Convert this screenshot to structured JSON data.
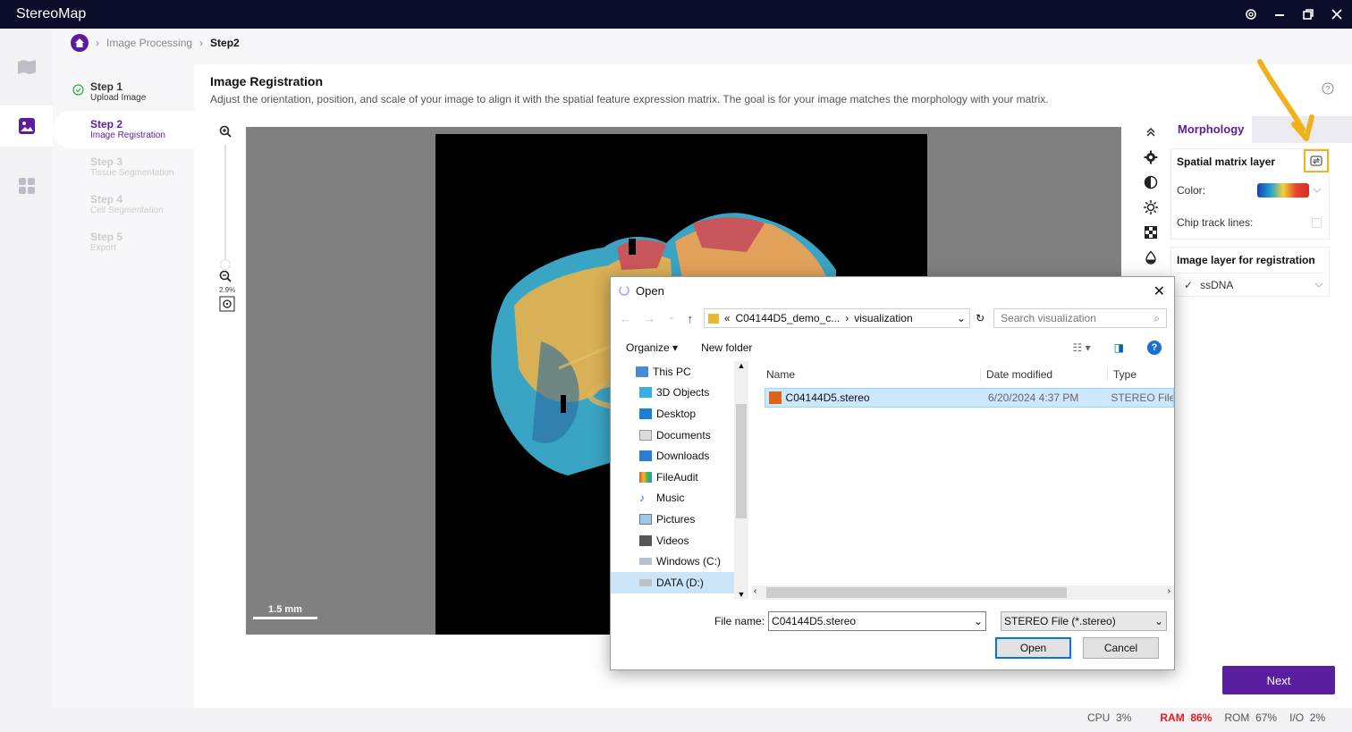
{
  "app": {
    "title": "StereoMap"
  },
  "breadcrumb": {
    "parent": "Image Processing",
    "current": "Step2"
  },
  "steps": [
    {
      "title": "Step 1",
      "subtitle": "Upload Image",
      "state": "done"
    },
    {
      "title": "Step 2",
      "subtitle": "Image Registration",
      "state": "active"
    },
    {
      "title": "Step 3",
      "subtitle": "Tissue Segmentation",
      "state": "pending"
    },
    {
      "title": "Step 4",
      "subtitle": "Cell Segmentation",
      "state": "pending"
    },
    {
      "title": "Step 5",
      "subtitle": "Export",
      "state": "pending"
    }
  ],
  "registration": {
    "title": "Image Registration",
    "description": "Adjust the orientation, position, and scale of your image to align it with the spatial feature expression matrix. The goal is for your image matches the morphology with your matrix."
  },
  "viewer": {
    "zoom_level": "2.9%",
    "scale_label": "1.5 mm"
  },
  "panel": {
    "tab": "Morphology",
    "spatial_section": "Spatial matrix layer",
    "color_label": "Color:",
    "chip_label": "Chip track lines:",
    "image_section": "Image layer for registration",
    "image_layer": "ssDNA"
  },
  "next_label": "Next",
  "status": {
    "cpu_label": "CPU",
    "cpu": "3%",
    "ram_label": "RAM",
    "ram": "86%",
    "rom_label": "ROM",
    "rom": "67%",
    "io_label": "I/O",
    "io": "2%"
  },
  "dialog": {
    "title": "Open",
    "path_prefix": "«",
    "path_folder": "C04144D5_demo_c...",
    "path_current": "visualization",
    "search_placeholder": "Search visualization",
    "organize": "Organize",
    "new_folder": "New folder",
    "tree": [
      "This PC",
      "3D Objects",
      "Desktop",
      "Documents",
      "Downloads",
      "FileAudit",
      "Music",
      "Pictures",
      "Videos",
      "Windows (C:)",
      "DATA (D:)"
    ],
    "columns": {
      "name": "Name",
      "date": "Date modified",
      "type": "Type"
    },
    "files": [
      {
        "name": "C04144D5.stereo",
        "date": "6/20/2024 4:37 PM",
        "type": "STEREO File"
      }
    ],
    "file_name_label": "File name:",
    "file_name_value": "C04144D5.stereo",
    "file_type": "STEREO File (*.stereo)",
    "open_label": "Open",
    "cancel_label": "Cancel"
  },
  "colors": {
    "accent": "#5a1fa0",
    "highlight": "#f0b21a",
    "ram_alert": "#e31b1b"
  }
}
